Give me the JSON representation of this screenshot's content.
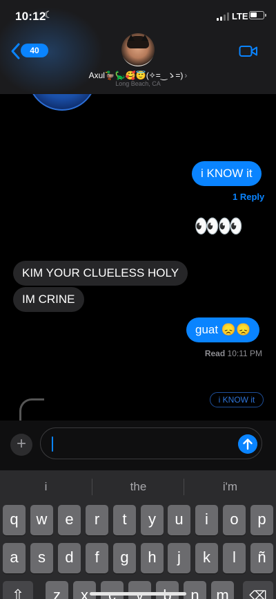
{
  "status_bar": {
    "time": "10:12",
    "network": "LTE"
  },
  "header": {
    "back_count": "40",
    "contact_name": "Axul🦆🦕🥰😇(✧=‿ゝ=)",
    "location": "Long Beach, CA"
  },
  "messages": {
    "m1": "i KNOW it",
    "m1_reply": "1 Reply",
    "m2": "👀👀",
    "m3": "KIM YOUR CLUELESS HOLY",
    "m4": "IM CRINE",
    "m5": "guat 😞😞",
    "read_label": "Read",
    "read_time": "10:11 PM",
    "preview": "i KNOW it"
  },
  "keyboard": {
    "suggestions": [
      "i",
      "the",
      "i'm"
    ],
    "row1": [
      "q",
      "w",
      "e",
      "r",
      "t",
      "y",
      "u",
      "i",
      "o",
      "p"
    ],
    "row2": [
      "a",
      "s",
      "d",
      "f",
      "g",
      "h",
      "j",
      "k",
      "l",
      "ñ"
    ],
    "row3": [
      "z",
      "x",
      "c",
      "v",
      "b",
      "n",
      "m"
    ]
  },
  "colors": {
    "accent": "#0a84ff",
    "received_bubble": "#262628",
    "background": "#000000"
  },
  "icons": [
    "back-chevron-icon",
    "video-call-icon",
    "plus-icon",
    "send-arrow-icon",
    "shift-icon",
    "delete-icon",
    "moon-icon"
  ]
}
